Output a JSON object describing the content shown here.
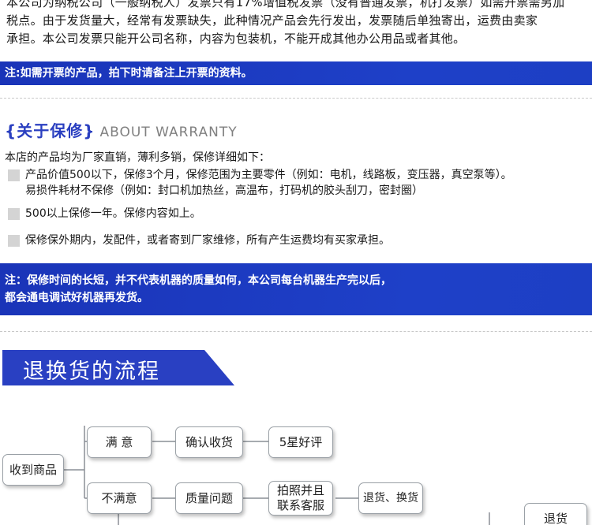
{
  "invoice_notice": {
    "line1": "本公司为纳税公司（一般纳税人）发票只有17%增值税发票（没有普通发票，机打发票）如需开票需另加",
    "line2": "税点。由于发货量大，经常有发票缺失，此种情况产品会先行发出，发票随后单独寄出，运费由卖家",
    "line3": "承担。本公司发票只能开公司名称，内容为包装机，不能开成其他办公用品或者其他。"
  },
  "invoice_band": "注:如需开票的产品，拍下时请备注上开票的资料。",
  "warranty": {
    "heading_cn": "{关于保修}",
    "heading_en": "ABOUT WARRANTY",
    "intro": "本店的产品均为厂家直销，薄利多销，保修详细如下：",
    "items": [
      {
        "line1": "产品价值500以下，保修3个月，保修范围为主要零件（例如：电机，线路板，变压器，真空泵等）。",
        "line2": "易损件耗材不保修（例如：封口机加热丝，高温布，打码机的胶头刮刀，密封圈）"
      },
      {
        "line1": "500以上保修一年。保修内容如上。"
      },
      {
        "line1": "保修保外期内，发配件，或者寄到厂家维修，所有产生运费均有买家承担。"
      }
    ]
  },
  "warranty_band": {
    "line1": "注：保修时间的长短，并不代表机器的质量如何，本公司每台机器生产完以后，",
    "line2": "都会通电调试好机器再发货。"
  },
  "flow": {
    "title": "退换货的流程",
    "nodes": {
      "received": "收到商品",
      "satisfied": "满 意",
      "confirm": "确认收货",
      "five_star": "5星好评",
      "unsatisfied": "不满意",
      "quality": "质量问题",
      "photo_line1": "拍照并且",
      "photo_line2": "联系客服",
      "return_exchange": "退货、换货",
      "refund": "退货"
    }
  }
}
